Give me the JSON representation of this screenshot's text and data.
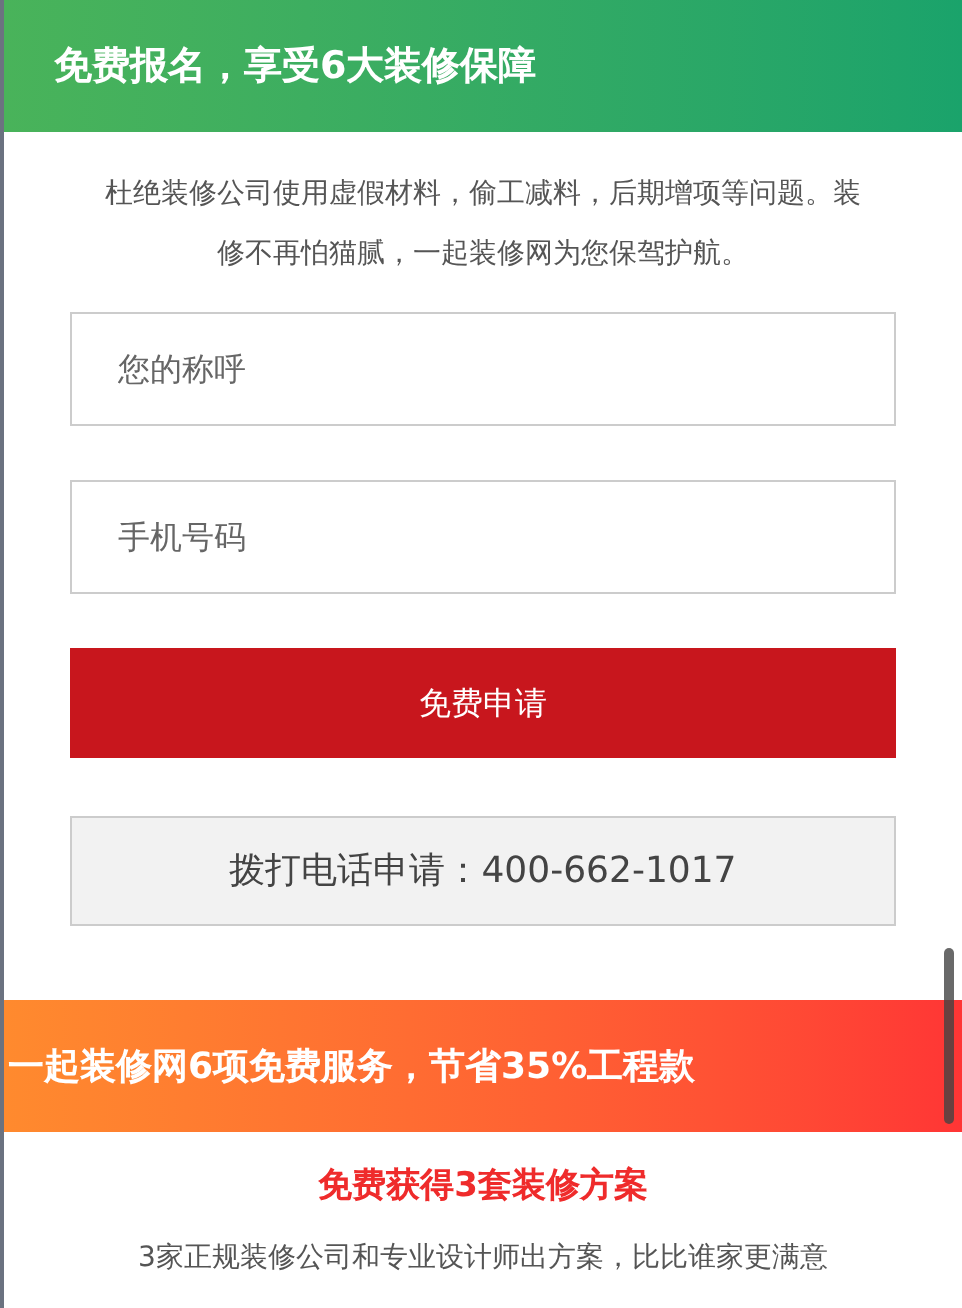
{
  "header": {
    "title": "免费报名，享受6大装修保障"
  },
  "intro": "杜绝装修公司使用虚假材料，偷工减料，后期增项等问题。装修不再怕猫腻，一起装修网为您保驾护航。",
  "form": {
    "fields": [
      {
        "placeholder": "您的称呼"
      },
      {
        "placeholder": "手机号码"
      }
    ],
    "submit": "免费申请",
    "phone": "拨打电话申请：400-662-1017"
  },
  "services": {
    "title": "一起装修网6项免费服务，节省35%工程款",
    "heading": "免费获得3套装修方案",
    "text": "3家正规装修公司和专业设计师出方案，比比谁家更满意"
  }
}
